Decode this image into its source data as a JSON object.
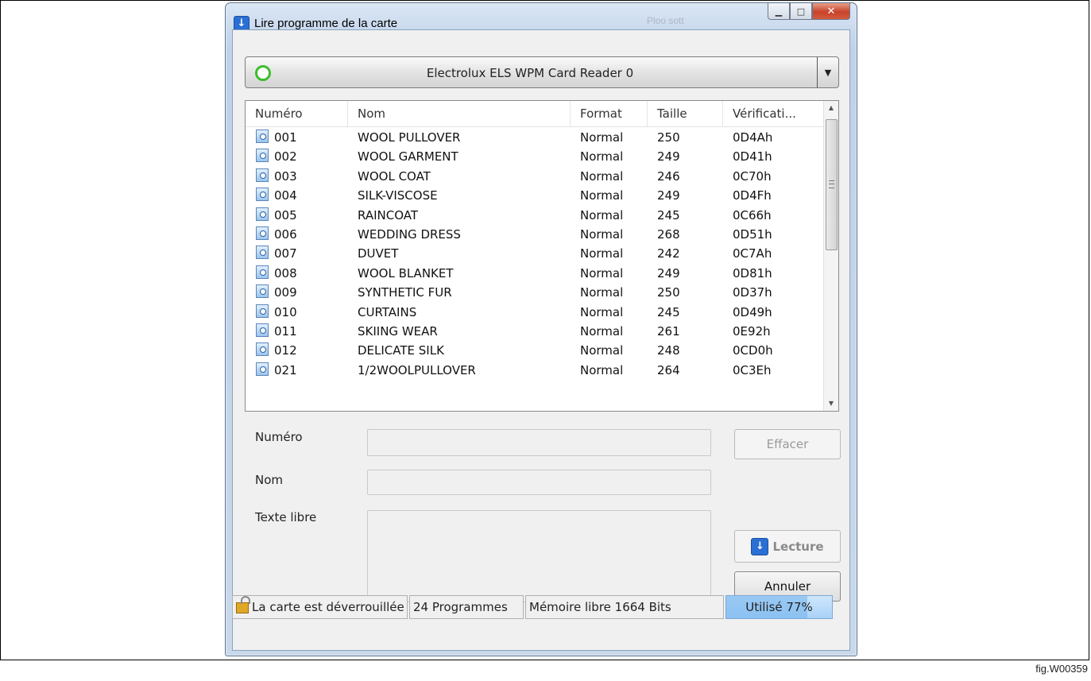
{
  "window": {
    "title": "Lire programme de la carte",
    "ghost_text": "Ploo sott"
  },
  "reader": {
    "label": "Electrolux ELS WPM Card Reader 0",
    "status_color": "#3cbd2d"
  },
  "table": {
    "columns": [
      "Numéro",
      "Nom",
      "Format",
      "Taille",
      "Vérificati..."
    ],
    "rows": [
      {
        "number": "001",
        "name": "WOOL PULLOVER",
        "format": "Normal",
        "size": "250",
        "check": "0D4Ah"
      },
      {
        "number": "002",
        "name": "WOOL GARMENT",
        "format": "Normal",
        "size": "249",
        "check": "0D41h"
      },
      {
        "number": "003",
        "name": "WOOL COAT",
        "format": "Normal",
        "size": "246",
        "check": "0C70h"
      },
      {
        "number": "004",
        "name": "SILK-VISCOSE",
        "format": "Normal",
        "size": "249",
        "check": "0D4Fh"
      },
      {
        "number": "005",
        "name": "RAINCOAT",
        "format": "Normal",
        "size": "245",
        "check": "0C66h"
      },
      {
        "number": "006",
        "name": "WEDDING DRESS",
        "format": "Normal",
        "size": "268",
        "check": "0D51h"
      },
      {
        "number": "007",
        "name": "DUVET",
        "format": "Normal",
        "size": "242",
        "check": "0C7Ah"
      },
      {
        "number": "008",
        "name": "WOOL BLANKET",
        "format": "Normal",
        "size": "249",
        "check": "0D81h"
      },
      {
        "number": "009",
        "name": "SYNTHETIC FUR",
        "format": "Normal",
        "size": "250",
        "check": "0D37h"
      },
      {
        "number": "010",
        "name": "CURTAINS",
        "format": "Normal",
        "size": "245",
        "check": "0D49h"
      },
      {
        "number": "011",
        "name": "SKIING WEAR",
        "format": "Normal",
        "size": "261",
        "check": "0E92h"
      },
      {
        "number": "012",
        "name": "DELICATE SILK",
        "format": "Normal",
        "size": "248",
        "check": "0CD0h"
      },
      {
        "number": "021",
        "name": "1/2WOOLPULLOVER",
        "format": "Normal",
        "size": "264",
        "check": "0C3Eh"
      }
    ]
  },
  "form": {
    "number_label": "Numéro",
    "name_label": "Nom",
    "text_label": "Texte libre",
    "number_value": "",
    "name_value": "",
    "text_value": ""
  },
  "buttons": {
    "clear": "Effacer",
    "read": "Lecture",
    "cancel": "Annuler"
  },
  "status": {
    "lock_text": "La carte est déverrouillée",
    "programs": "24 Programmes",
    "free_memory": "Mémoire libre 1664 Bits",
    "usage_text": "Utilisé 77%",
    "usage_fraction": 0.77
  },
  "caption": "fig.W00359"
}
